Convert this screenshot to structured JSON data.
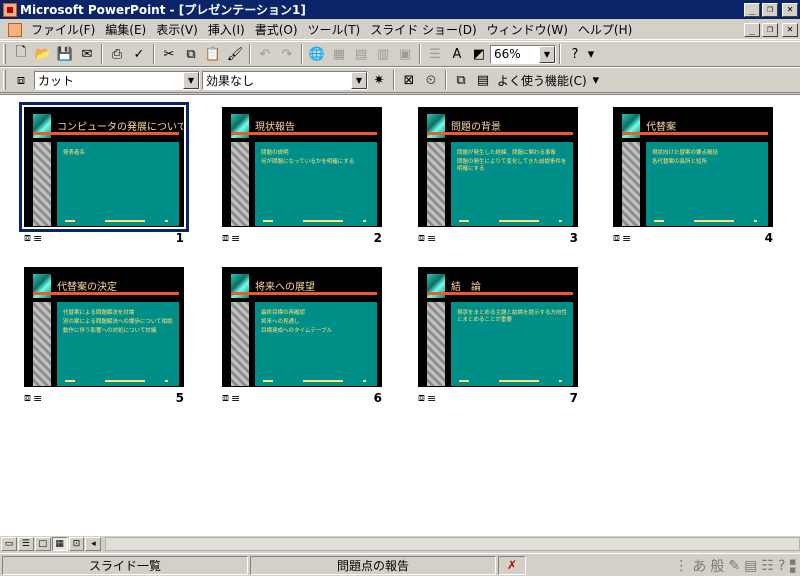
{
  "window": {
    "title": "Microsoft PowerPoint - [プレゼンテーション1]"
  },
  "menu": [
    "ファイル(F)",
    "編集(E)",
    "表示(V)",
    "挿入(I)",
    "書式(O)",
    "ツール(T)",
    "スライド ショー(D)",
    "ウィンドウ(W)",
    "ヘルプ(H)"
  ],
  "toolbar": {
    "zoom": "66%",
    "transition_effect": "カット",
    "animation_effect": "効果なし",
    "common_tasks": "よく使う機能(C)"
  },
  "slides": [
    {
      "number": "1",
      "title": "コンピュータの発展について",
      "bullets": [
        "発表者名"
      ],
      "selected": true
    },
    {
      "number": "2",
      "title": "現状報告",
      "bullets": [
        "問題の説明",
        "何が問題になっているかを明確にする"
      ]
    },
    {
      "number": "3",
      "title": "問題の背景",
      "bullets": [
        "問題が発生した経緯、問題に関わる事象",
        "問題の発生によりて変化してきた前提条件を明確にする"
      ]
    },
    {
      "number": "4",
      "title": "代替案",
      "bullets": [
        "現状向けた替案の要点概括",
        "各代替案の長所と短所"
      ]
    },
    {
      "number": "5",
      "title": "代替案の決定",
      "bullets": [
        "代替案による問題解決を討論",
        "別の案による問題解決への譲歩について相談",
        "動作に伴う影響への対処について討議"
      ]
    },
    {
      "number": "6",
      "title": "将来への展望",
      "bullets": [
        "最終目標の再確認",
        "将来への見通し",
        "目標達成へのタイムテーブル"
      ]
    },
    {
      "number": "7",
      "title": "結　論",
      "bullets": [
        "現状をまとめる主題と結論を提示する方向性とまとめることが重要"
      ]
    }
  ],
  "statusbar": {
    "view": "スライド一覧",
    "template": "問題点の報告"
  },
  "colors": {
    "title_bar": "#0a246a",
    "slide_bg": "#000000",
    "slide_body": "#008f88",
    "slide_accent": "#f05a28",
    "slide_text": "#ffe07a"
  }
}
